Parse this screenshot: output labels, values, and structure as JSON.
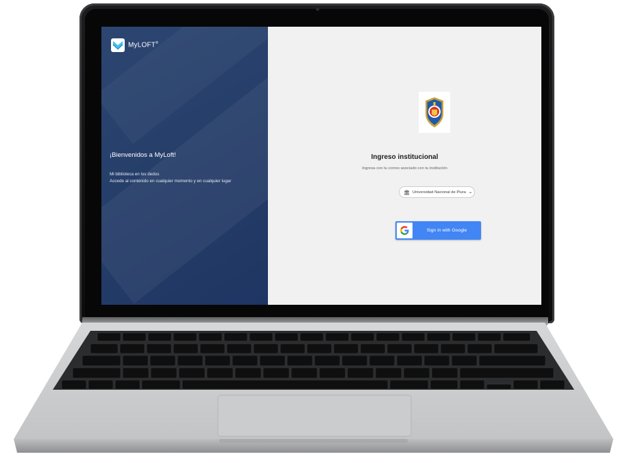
{
  "brand": {
    "name": "MyLOFT",
    "trademark": "®"
  },
  "left_panel": {
    "welcome": "¡Bienvenidos a MyLoft!",
    "tagline_line1": "Mi biblioteca en los dedos",
    "tagline_line2": "Accede al contenido en cualquier momento y en cualquier lugar"
  },
  "login": {
    "title": "Ingreso institucional",
    "subtitle": "Ingresa con tu correo asociado con tu institución",
    "institution": "Universidad Nacional de Piura",
    "google_button": "Sign in with Google"
  },
  "icons": {
    "logo": "myloft-logo-icon",
    "crest": "university-crest-icon",
    "institution": "bank-icon",
    "dropdown": "chevron-down-icon",
    "google": "google-icon"
  },
  "colors": {
    "left_panel": "#263f6a",
    "right_panel": "#f1f1f1",
    "google_blue": "#4285f4",
    "logo_accent": "#3cc4ee"
  }
}
